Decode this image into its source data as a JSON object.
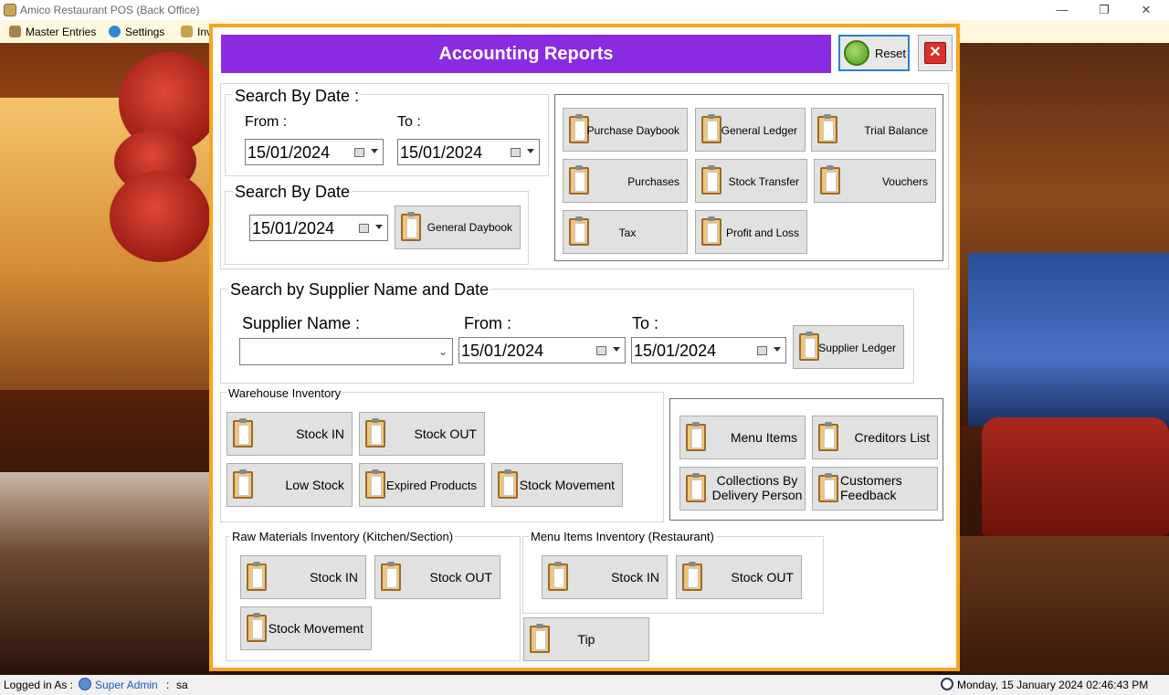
{
  "window": {
    "title": "Amico Restaurant POS (Back Office)",
    "controls": [
      "—",
      "❐",
      "✕"
    ]
  },
  "menubar": {
    "items": [
      {
        "label": "Master Entries",
        "icon": "box-icon"
      },
      {
        "label": "Settings",
        "icon": "gear-icon"
      },
      {
        "label": "Inv",
        "icon": "inventory-icon"
      }
    ]
  },
  "dialog": {
    "title": "Accounting Reports",
    "reset_label": "Reset",
    "close_label": "✕",
    "search_by_date_range": {
      "legend": "Search By Date :",
      "from_label": "From :",
      "to_label": "To :",
      "from_value": "15/01/2024",
      "to_value": "15/01/2024"
    },
    "search_by_date_single": {
      "legend": "Search By Date",
      "date_value": "15/01/2024",
      "button": "General Daybook"
    },
    "report_buttons": [
      "Purchase Daybook",
      "General Ledger",
      "Trial Balance",
      "Purchases",
      "Stock Transfer",
      "Vouchers",
      "Tax",
      "Profit and Loss"
    ],
    "supplier_search": {
      "legend": "Search by Supplier Name and Date",
      "supplier_label": "Supplier Name :",
      "supplier_value": "",
      "from_label": "From :",
      "to_label": "To :",
      "from_value": "15/01/2024",
      "to_value": "15/01/2024",
      "button": "Supplier Ledger"
    },
    "warehouse": {
      "legend": "Warehouse Inventory",
      "buttons": [
        "Stock IN",
        "Stock OUT",
        "Low Stock",
        "Expired Products",
        "Stock Movement"
      ]
    },
    "right_panel": {
      "buttons": [
        "Menu Items",
        "Creditors List",
        "Collections By\nDelivery Person",
        "Customers\nFeedback"
      ]
    },
    "raw_materials": {
      "legend": "Raw Materials Inventory (Kitchen/Section)",
      "buttons": [
        "Stock IN",
        "Stock OUT",
        "Stock Movement"
      ]
    },
    "menu_items_inventory": {
      "legend": "Menu Items Inventory (Restaurant)",
      "buttons": [
        "Stock IN",
        "Stock OUT"
      ]
    },
    "tip_button": "Tip"
  },
  "statusbar": {
    "logged_in_label": "Logged in As :",
    "user_role": "Super Admin",
    "separator": ":",
    "username": "sa",
    "datetime": "Monday, 15 January 2024 02:46:43 PM"
  },
  "colors": {
    "title_bar": "#8a2be2",
    "dialog_border": "#f5a623",
    "reset_border": "#2a7fd4",
    "close_red": "#d9322c",
    "user_link": "#1a5ab8"
  }
}
